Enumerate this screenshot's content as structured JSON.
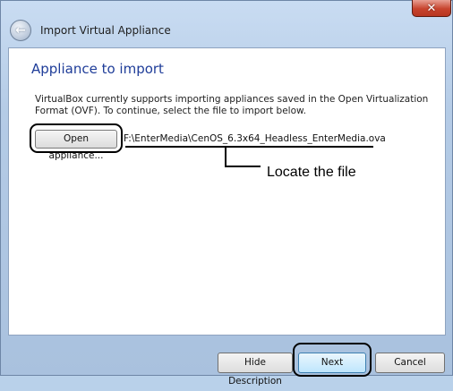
{
  "window": {
    "title": "Import Virtual Appliance",
    "close_glyph": "✕",
    "back_glyph": "←"
  },
  "page": {
    "heading": "Appliance to import",
    "description": "VirtualBox currently supports importing appliances saved in the Open Virtualization Format (OVF). To continue, select the file to import below.",
    "open_button_label": "Open appliance...",
    "file_path": "F:\\EnterMedia\\CenOS_6.3x64_Headless_EnterMedia.ova"
  },
  "annotation": {
    "text": "Locate the file"
  },
  "footer": {
    "hide_description_label": "Hide Description",
    "next_label": "Next",
    "cancel_label": "Cancel"
  },
  "colors": {
    "heading": "#1f3d99",
    "frame": "#b9d1ea",
    "close": "#c7432d"
  }
}
